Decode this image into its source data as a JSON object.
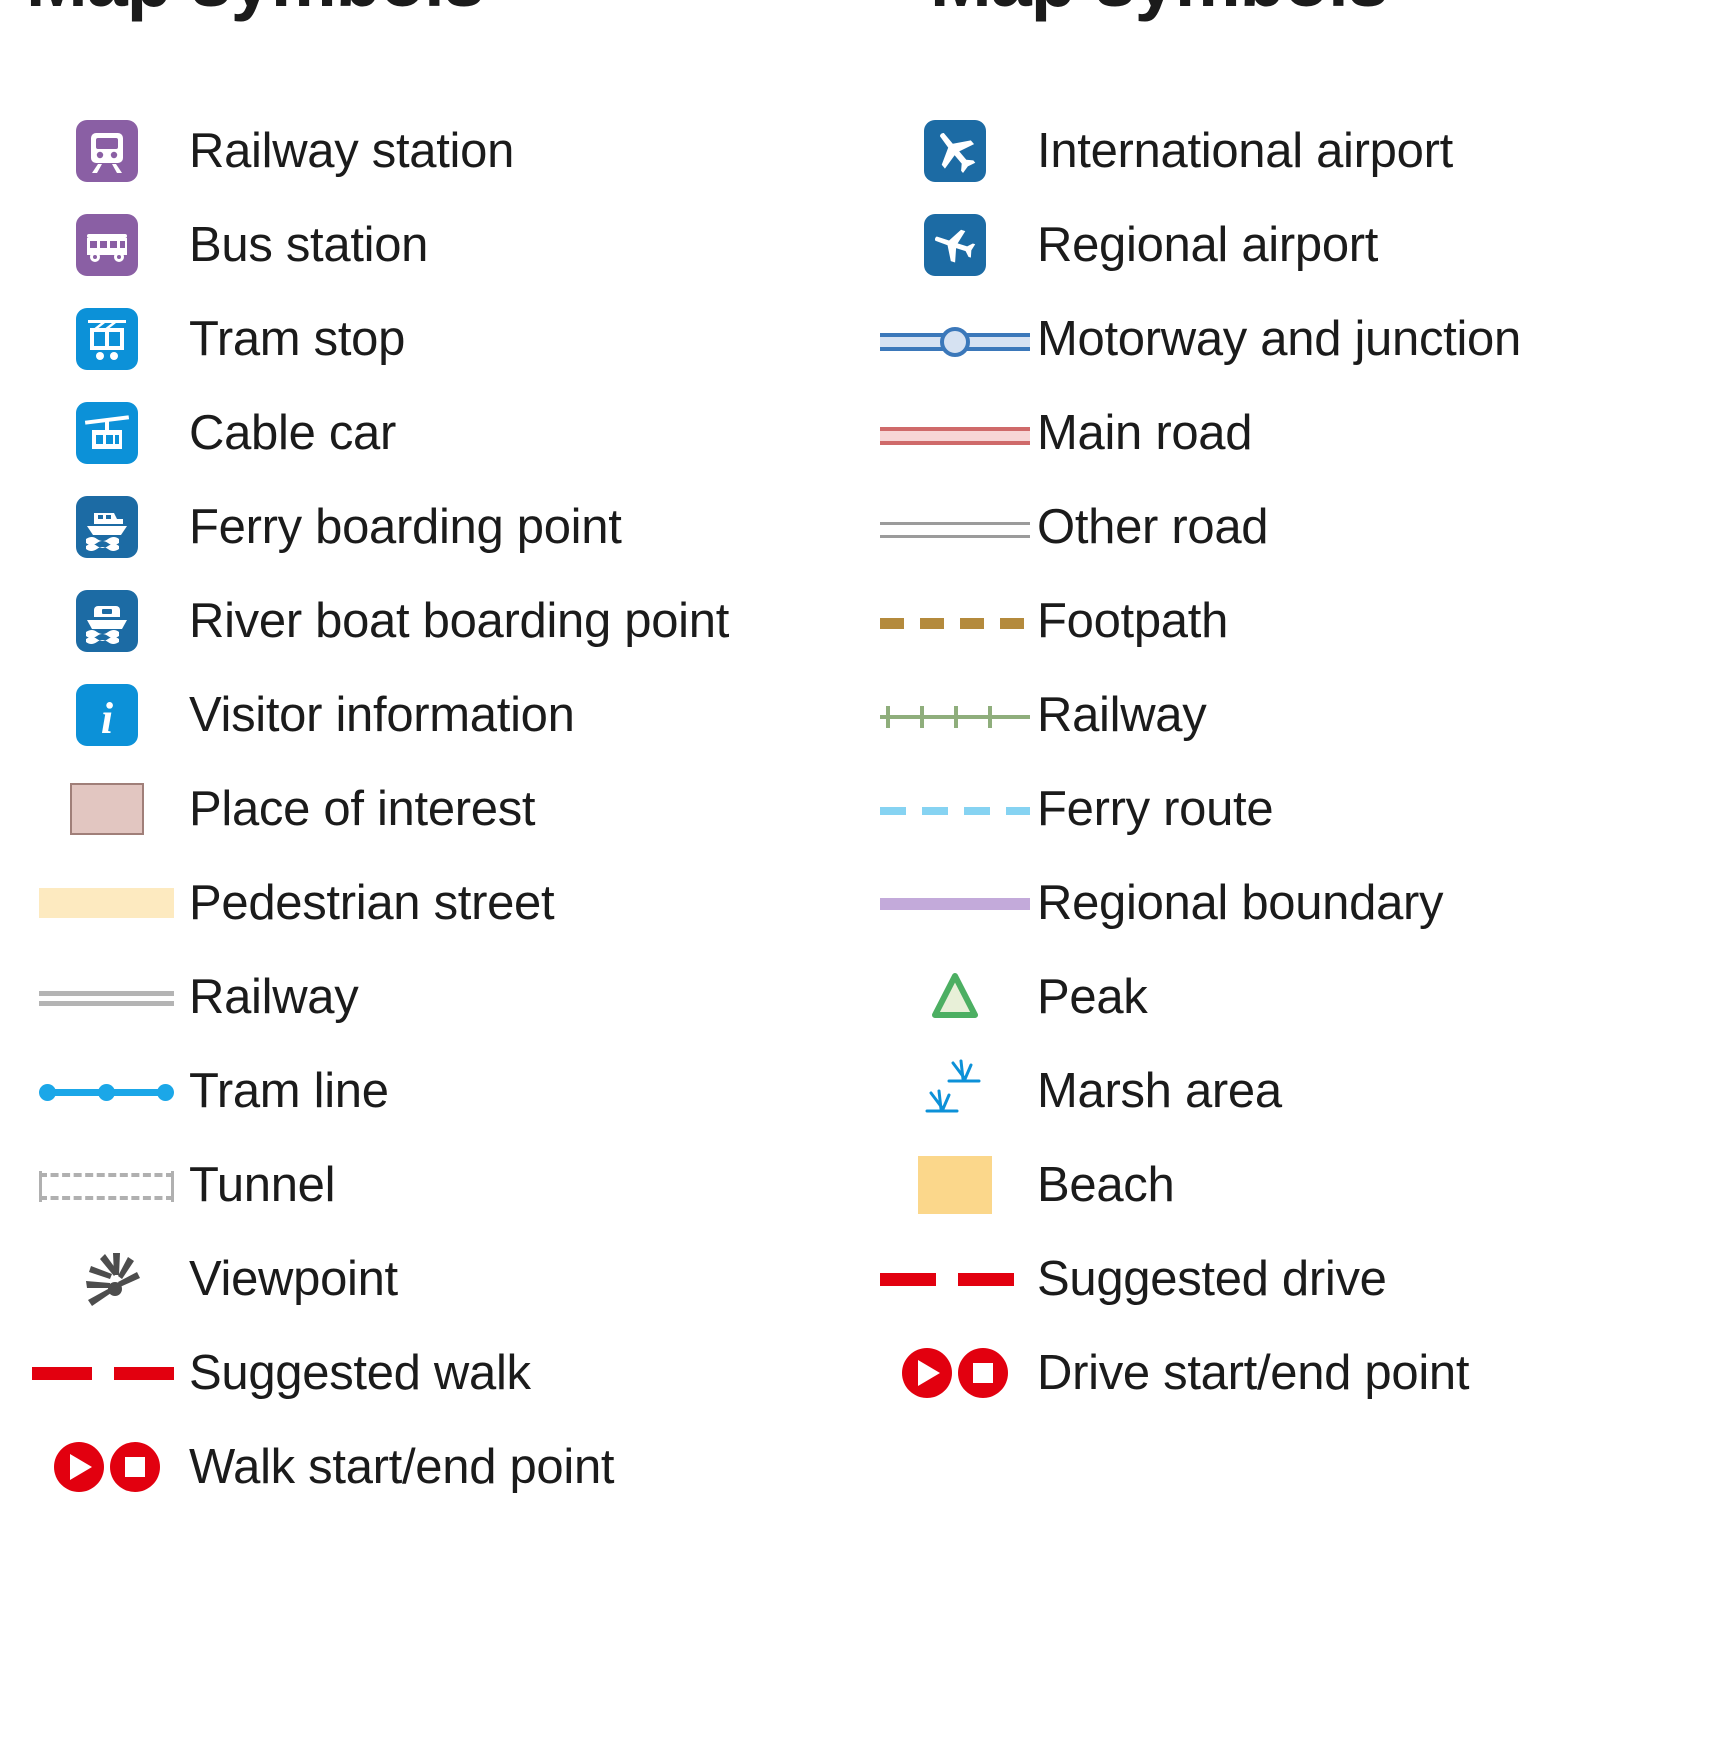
{
  "headings": {
    "left": "Map symbols",
    "right": "Map symbols"
  },
  "colors": {
    "rail_purple": "#8a5fa4",
    "transit_blue": "#0c91d8",
    "water_blue": "#1c6ba4",
    "route_red": "#e2000f",
    "poi_pink": "#e2c6c1",
    "pedestrian_cream": "#fdeac0",
    "beach_orange": "#fbd78b",
    "motorway_blue": "#3b78ba",
    "main_road_red": "#cf6a6a",
    "footpath_brown": "#b48a3c",
    "railway_green": "#8fae7c",
    "ferry_cyan": "#86d3f2",
    "boundary_purple": "#c3aada",
    "peak_green": "#4caf62",
    "marsh_blue": "#0c91d8",
    "text_black": "#1b1b1b"
  },
  "left_column": {
    "items": [
      {
        "symbol": "railway-station-icon",
        "label": "Railway station"
      },
      {
        "symbol": "bus-station-icon",
        "label": "Bus station"
      },
      {
        "symbol": "tram-stop-icon",
        "label": "Tram stop"
      },
      {
        "symbol": "cable-car-icon",
        "label": "Cable car"
      },
      {
        "symbol": "ferry-boarding-icon",
        "label": "Ferry boarding point"
      },
      {
        "symbol": "river-boat-boarding-icon",
        "label": "River boat boarding point"
      },
      {
        "symbol": "visitor-information-icon",
        "label": "Visitor information"
      },
      {
        "symbol": "place-of-interest-swatch",
        "label": "Place of interest"
      },
      {
        "symbol": "pedestrian-street-swatch",
        "label": "Pedestrian street"
      },
      {
        "symbol": "railway-line-symbol",
        "label": "Railway"
      },
      {
        "symbol": "tram-line-symbol",
        "label": "Tram line"
      },
      {
        "symbol": "tunnel-symbol",
        "label": "Tunnel"
      },
      {
        "symbol": "viewpoint-icon",
        "label": "Viewpoint"
      },
      {
        "symbol": "suggested-walk-symbol",
        "label": "Suggested walk"
      },
      {
        "symbol": "walk-start-end-icon",
        "label": "Walk start/end point"
      }
    ]
  },
  "right_column": {
    "items": [
      {
        "symbol": "international-airport-icon",
        "label": "International airport"
      },
      {
        "symbol": "regional-airport-icon",
        "label": "Regional airport"
      },
      {
        "symbol": "motorway-junction-symbol",
        "label": "Motorway and junction"
      },
      {
        "symbol": "main-road-symbol",
        "label": "Main road"
      },
      {
        "symbol": "other-road-symbol",
        "label": "Other road"
      },
      {
        "symbol": "footpath-symbol",
        "label": "Footpath"
      },
      {
        "symbol": "railway-symbol",
        "label": "Railway"
      },
      {
        "symbol": "ferry-route-symbol",
        "label": "Ferry route"
      },
      {
        "symbol": "regional-boundary-symbol",
        "label": "Regional boundary"
      },
      {
        "symbol": "peak-icon",
        "label": "Peak"
      },
      {
        "symbol": "marsh-area-icon",
        "label": "Marsh area"
      },
      {
        "symbol": "beach-swatch",
        "label": "Beach"
      },
      {
        "symbol": "suggested-drive-symbol",
        "label": "Suggested drive"
      },
      {
        "symbol": "drive-start-end-icon",
        "label": "Drive start/end point"
      }
    ]
  }
}
